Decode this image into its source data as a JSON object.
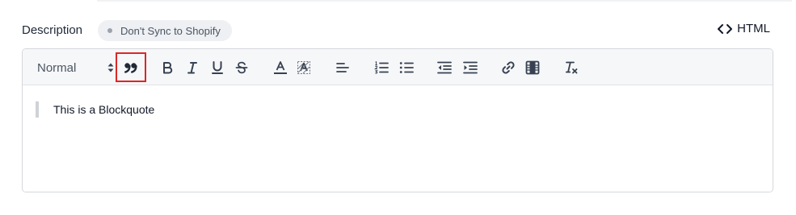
{
  "field": {
    "label": "Description",
    "sync_badge": "Don't Sync to Shopify",
    "html_toggle": "HTML"
  },
  "toolbar": {
    "format_value": "Normal",
    "buttons": [
      "blockquote",
      "bold",
      "italic",
      "underline",
      "strikethrough",
      "text-color",
      "background-color",
      "align",
      "ordered-list",
      "bullet-list",
      "outdent",
      "indent",
      "link",
      "video",
      "clear-formatting"
    ],
    "highlighted_button": "blockquote"
  },
  "content": {
    "blockquote_text": "This is a Blockquote"
  },
  "colors": {
    "highlight": "#dc2626",
    "toolbar_bg": "#f6f7f9",
    "badge_bg": "#eef0f3"
  }
}
